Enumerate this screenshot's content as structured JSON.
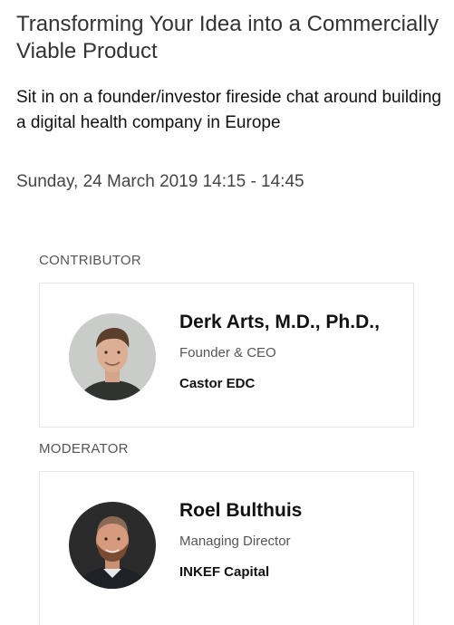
{
  "session": {
    "title": "Transforming Your Idea into a Commercially Viable Product",
    "description": "Sit in on a founder/investor fireside chat around building a digital health company in Europe",
    "datetime": "Sunday, 24 March 2019 14:15 - 14:45"
  },
  "contributor": {
    "section_label": "CONTRIBUTOR",
    "name": "Derk Arts, M.D., Ph.D.,",
    "role": "Founder & CEO",
    "company": "Castor EDC"
  },
  "moderator": {
    "section_label": "MODERATOR",
    "name": "Roel Bulthuis",
    "role": "Managing Director",
    "company": "INKEF Capital"
  },
  "colors": {
    "text_primary": "#111111",
    "text_secondary": "#555555",
    "card_border": "#e6e6e6",
    "background": "#ffffff"
  }
}
